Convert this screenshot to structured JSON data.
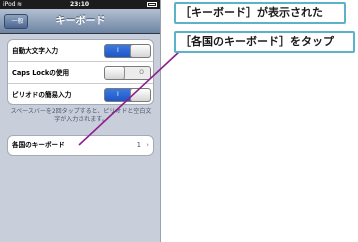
{
  "status_bar": {
    "carrier": "iPod",
    "time": "23:10"
  },
  "nav_bar": {
    "back_label": "一般",
    "title": "キーボード"
  },
  "settings": [
    {
      "label": "自動大文字入力",
      "state": "on",
      "mark": "I"
    },
    {
      "label": "Caps Lockの使用",
      "state": "off",
      "mark": "O"
    },
    {
      "label": "ピリオドの簡易入力",
      "state": "on",
      "mark": "I"
    }
  ],
  "period_note": "スペースバーを2回タップすると、ピリオドと空白文字が入力されます。",
  "international": {
    "label": "各国のキーボード",
    "count": "1"
  },
  "callouts": {
    "status": "［キーボード］が表示された",
    "action": "［各国のキーボード］をタップ"
  },
  "colors": {
    "callout_border": "#5cb3c9",
    "leader_line": "#8c1f8c",
    "toggle_on": "#2a66d6"
  }
}
